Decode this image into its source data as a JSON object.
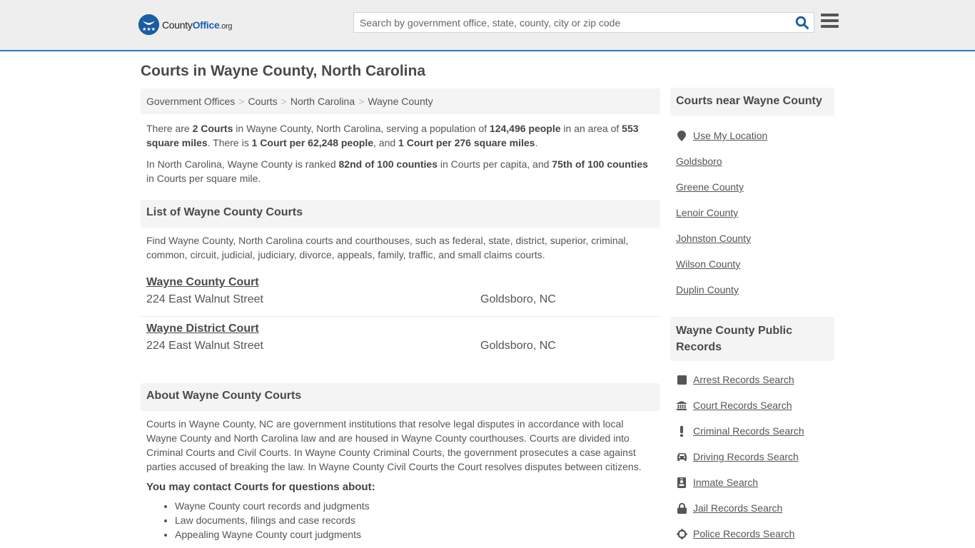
{
  "header": {
    "logo_text_county": "County",
    "logo_text_office": "Office",
    "logo_text_org": ".org",
    "search_placeholder": "Search by government office, state, county, city or zip code",
    "colors": {
      "brand_blue": "#1a5da6",
      "header_border": "#2e7ab8",
      "header_bg": "#eeeeee"
    }
  },
  "page_title": "Courts in Wayne County, North Carolina",
  "breadcrumb": [
    {
      "label": "Government Offices"
    },
    {
      "label": "Courts"
    },
    {
      "label": "North Carolina"
    },
    {
      "label": "Wayne County"
    }
  ],
  "breadcrumb_separator": ">",
  "intro": {
    "p1": {
      "t1": "There are ",
      "b1": "2 Courts",
      "t2": " in Wayne County, North Carolina, serving a population of ",
      "b2": "124,496 people",
      "t3": " in an area of ",
      "b3": "553 square miles",
      "t4": ". There is ",
      "b4": "1 Court per 62,248 people",
      "t5": ", and ",
      "b5": "1 Court per 276 square miles",
      "t6": "."
    },
    "p2": {
      "t1": "In North Carolina, Wayne County is ranked ",
      "b1": "82nd of 100 counties",
      "t2": " in Courts per capita, and ",
      "b2": "75th of 100 counties",
      "t3": " in Courts per square mile."
    }
  },
  "list_section": {
    "heading": "List of Wayne County Courts",
    "description": "Find Wayne County, North Carolina courts and courthouses, such as federal, state, district, superior, criminal, common, circuit, judicial, judiciary, divorce, appeals, family, traffic, and small claims courts.",
    "courts": [
      {
        "name": "Wayne County Court",
        "address": "224 East Walnut Street",
        "city": "Goldsboro, NC"
      },
      {
        "name": "Wayne District Court",
        "address": "224 East Walnut Street",
        "city": "Goldsboro, NC"
      }
    ]
  },
  "about_section": {
    "heading": "About Wayne County Courts",
    "body": "Courts in Wayne County, NC are government institutions that resolve legal disputes in accordance with local Wayne County and North Carolina law and are housed in Wayne County courthouses. Courts are divided into Criminal Courts and Civil Courts. In Wayne County Criminal Courts, the government prosecutes a case against parties accused of breaking the law. In Wayne County Civil Courts the Court resolves disputes between citizens.",
    "contact_heading": "You may contact Courts for questions about:",
    "topics": [
      "Wayne County court records and judgments",
      "Law documents, filings and case records",
      "Appealing Wayne County court judgments"
    ]
  },
  "sidebar": {
    "nearby_heading": "Courts near Wayne County",
    "use_location": {
      "label": "Use My Location",
      "icon": "map-marker-icon"
    },
    "nearby": [
      {
        "label": "Goldsboro"
      },
      {
        "label": "Greene County"
      },
      {
        "label": "Lenoir County"
      },
      {
        "label": "Johnston County"
      },
      {
        "label": "Wilson County"
      },
      {
        "label": "Duplin County"
      }
    ],
    "records_heading": "Wayne County Public Records",
    "records": [
      {
        "label": "Arrest Records Search",
        "icon": "square-icon"
      },
      {
        "label": "Court Records Search",
        "icon": "courthouse-icon"
      },
      {
        "label": "Criminal Records Search",
        "icon": "exclamation-icon"
      },
      {
        "label": "Driving Records Search",
        "icon": "car-icon"
      },
      {
        "label": "Inmate Search",
        "icon": "id-badge-icon"
      },
      {
        "label": "Jail Records Search",
        "icon": "lock-icon"
      },
      {
        "label": "Police Records Search",
        "icon": "crosshair-icon"
      }
    ]
  }
}
